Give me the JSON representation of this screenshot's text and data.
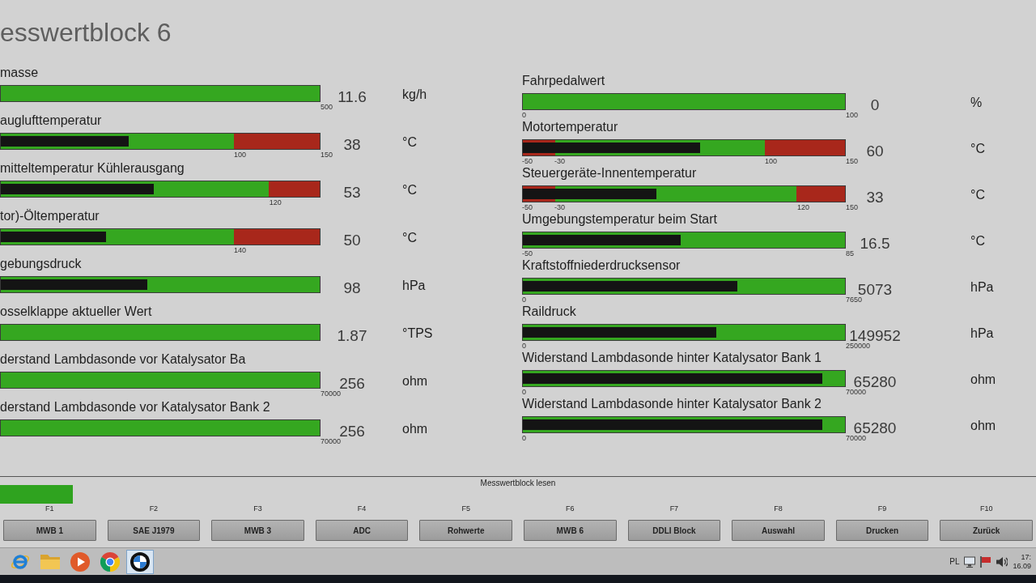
{
  "title": "esswertblock 6",
  "left": {
    "gauges": [
      {
        "label": "masse",
        "value": "11.6",
        "unit": "kg/h",
        "end_tick": "500"
      },
      {
        "label": "auglufttemperatur",
        "value": "38",
        "unit": "°C",
        "level": 0.4,
        "alarm_high": {
          "level": 0.27,
          "tick": "100"
        },
        "end_tick": "150"
      },
      {
        "label": "mitteltemperatur Kühlerausgang",
        "value": "53",
        "unit": "°C",
        "level": 0.48,
        "alarm_high": {
          "level": 0.16,
          "tick": "120"
        }
      },
      {
        "label": "tor)-Öltemperatur",
        "value": "50",
        "unit": "°C",
        "level": 0.33,
        "alarm_high": {
          "level": 0.27,
          "tick": "140"
        }
      },
      {
        "label": "gebungsdruck",
        "value": "98",
        "unit": "hPa",
        "level": 0.46
      },
      {
        "label": "osselklappe aktueller Wert",
        "value": "1.87",
        "unit": "°TPS"
      },
      {
        "label": "derstand Lambdasonde vor Katalysator Ba",
        "value": "256",
        "unit": "ohm",
        "end_tick": "70000"
      },
      {
        "label": "derstand Lambdasonde vor Katalysator Bank 2",
        "value": "256",
        "unit": "ohm",
        "end_tick": "70000"
      }
    ]
  },
  "right": {
    "gauges": [
      {
        "label": "Fahrpedalwert",
        "value": "0",
        "unit": "%",
        "start_tick": "0",
        "end_tick": "100"
      },
      {
        "label": "Motortemperatur",
        "value": "60",
        "unit": "°C",
        "level": 0.55,
        "start_tick": "-50",
        "alarm_low": {
          "level": 0.1,
          "tick": "-30"
        },
        "alarm_high": {
          "level": 0.25,
          "tick": "100"
        },
        "end_tick": "150"
      },
      {
        "label": "Steuergeräte-Innentemperatur",
        "value": "33",
        "unit": "°C",
        "level": 0.415,
        "start_tick": "-50",
        "alarm_low": {
          "level": 0.1,
          "tick": "-30"
        },
        "alarm_high": {
          "level": 0.15,
          "tick": "120"
        },
        "end_tick": "150"
      },
      {
        "label": "Umgebungstemperatur beim Start",
        "value": "16.5",
        "unit": "°C",
        "level": 0.49,
        "start_tick": "-50",
        "end_tick": "85"
      },
      {
        "label": "Kraftstoffniederdrucksensor",
        "value": "5073",
        "unit": "hPa",
        "level": 0.665,
        "start_tick": "0",
        "end_tick": "7650"
      },
      {
        "label": "Raildruck",
        "value": "149952",
        "unit": "hPa",
        "level": 0.6,
        "start_tick": "0",
        "end_tick": "250000"
      },
      {
        "label": "Widerstand Lambdasonde hinter Katalysator Bank 1",
        "value": "65280",
        "unit": "ohm",
        "level": 0.93,
        "start_tick": "0",
        "end_tick": "70000"
      },
      {
        "label": "Widerstand Lambdasonde hinter Katalysator Bank 2",
        "value": "65280",
        "unit": "ohm",
        "level": 0.93,
        "start_tick": "0",
        "end_tick": "70000"
      }
    ]
  },
  "status_bar": {
    "text": "Messwertblock lesen",
    "indicator_on": true
  },
  "function_keys": [
    {
      "key": "F1",
      "label": "MWB 1"
    },
    {
      "key": "F2",
      "label": "SAE J1979"
    },
    {
      "key": "F3",
      "label": "MWB 3"
    },
    {
      "key": "F4",
      "label": "ADC"
    },
    {
      "key": "F5",
      "label": "Rohwerte"
    },
    {
      "key": "F6",
      "label": "MWB 6"
    },
    {
      "key": "F7",
      "label": "DDLI Block"
    },
    {
      "key": "F8",
      "label": "Auswahl"
    },
    {
      "key": "F9",
      "label": "Drucken"
    },
    {
      "key": "F10",
      "label": "Zurück"
    }
  ],
  "taskbar": {
    "apps": [
      {
        "kind": "orbit",
        "selected": false
      },
      {
        "kind": "folder",
        "selected": false
      },
      {
        "kind": "play",
        "selected": false
      },
      {
        "kind": "segmented",
        "selected": false
      },
      {
        "kind": "quartered",
        "selected": true
      }
    ],
    "language": "PL",
    "time": "17:",
    "date": "16.09"
  }
}
